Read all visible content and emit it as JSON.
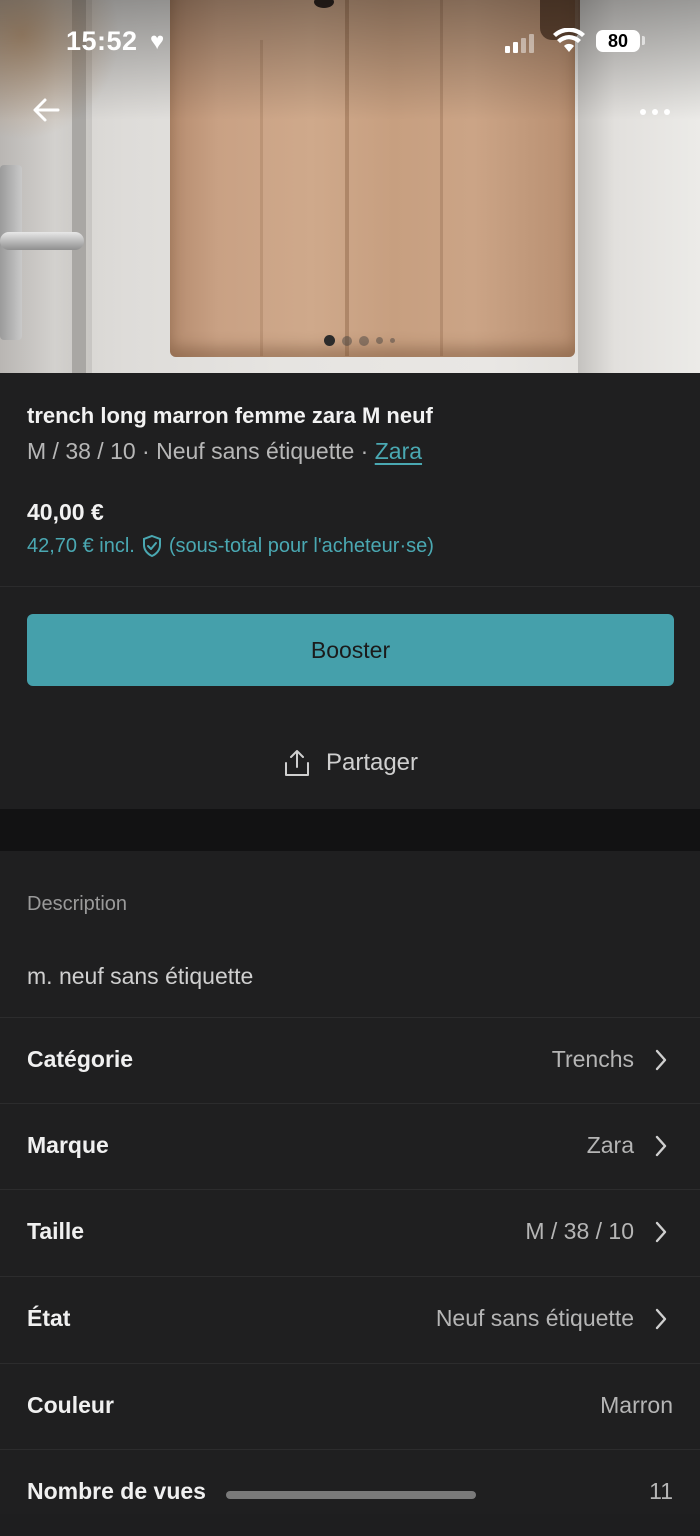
{
  "status_bar": {
    "time": "15:52",
    "battery": "80"
  },
  "photo": {
    "description_icon": "heart-icon",
    "carousel_count": 5,
    "carousel_active_index": 0
  },
  "listing": {
    "title": "trench long marron femme zara M neuf",
    "subtitle_prefix": "M / 38 / 10 · Neuf sans étiquette · ",
    "brand_link": "Zara",
    "price": "40,00 €",
    "price_incl_amount": "42,70 € incl.",
    "price_incl_note": "(sous-total pour l'acheteur·se)"
  },
  "actions": {
    "boost_label": "Booster",
    "share_label": "Partager"
  },
  "details": {
    "description_label": "Description",
    "description_text": "m. neuf sans étiquette",
    "rows": [
      {
        "label": "Catégorie",
        "value": "Trenchs"
      },
      {
        "label": "Marque",
        "value": "Zara"
      },
      {
        "label": "Taille",
        "value": "M / 38 / 10"
      },
      {
        "label": "État",
        "value": "Neuf sans étiquette"
      },
      {
        "label": "Couleur",
        "value": "Marron"
      },
      {
        "label": "Nombre de vues",
        "value": "11"
      }
    ]
  },
  "colors": {
    "accent": "#45a0ab",
    "link": "#4aa8b2",
    "background": "#1f1f20"
  }
}
